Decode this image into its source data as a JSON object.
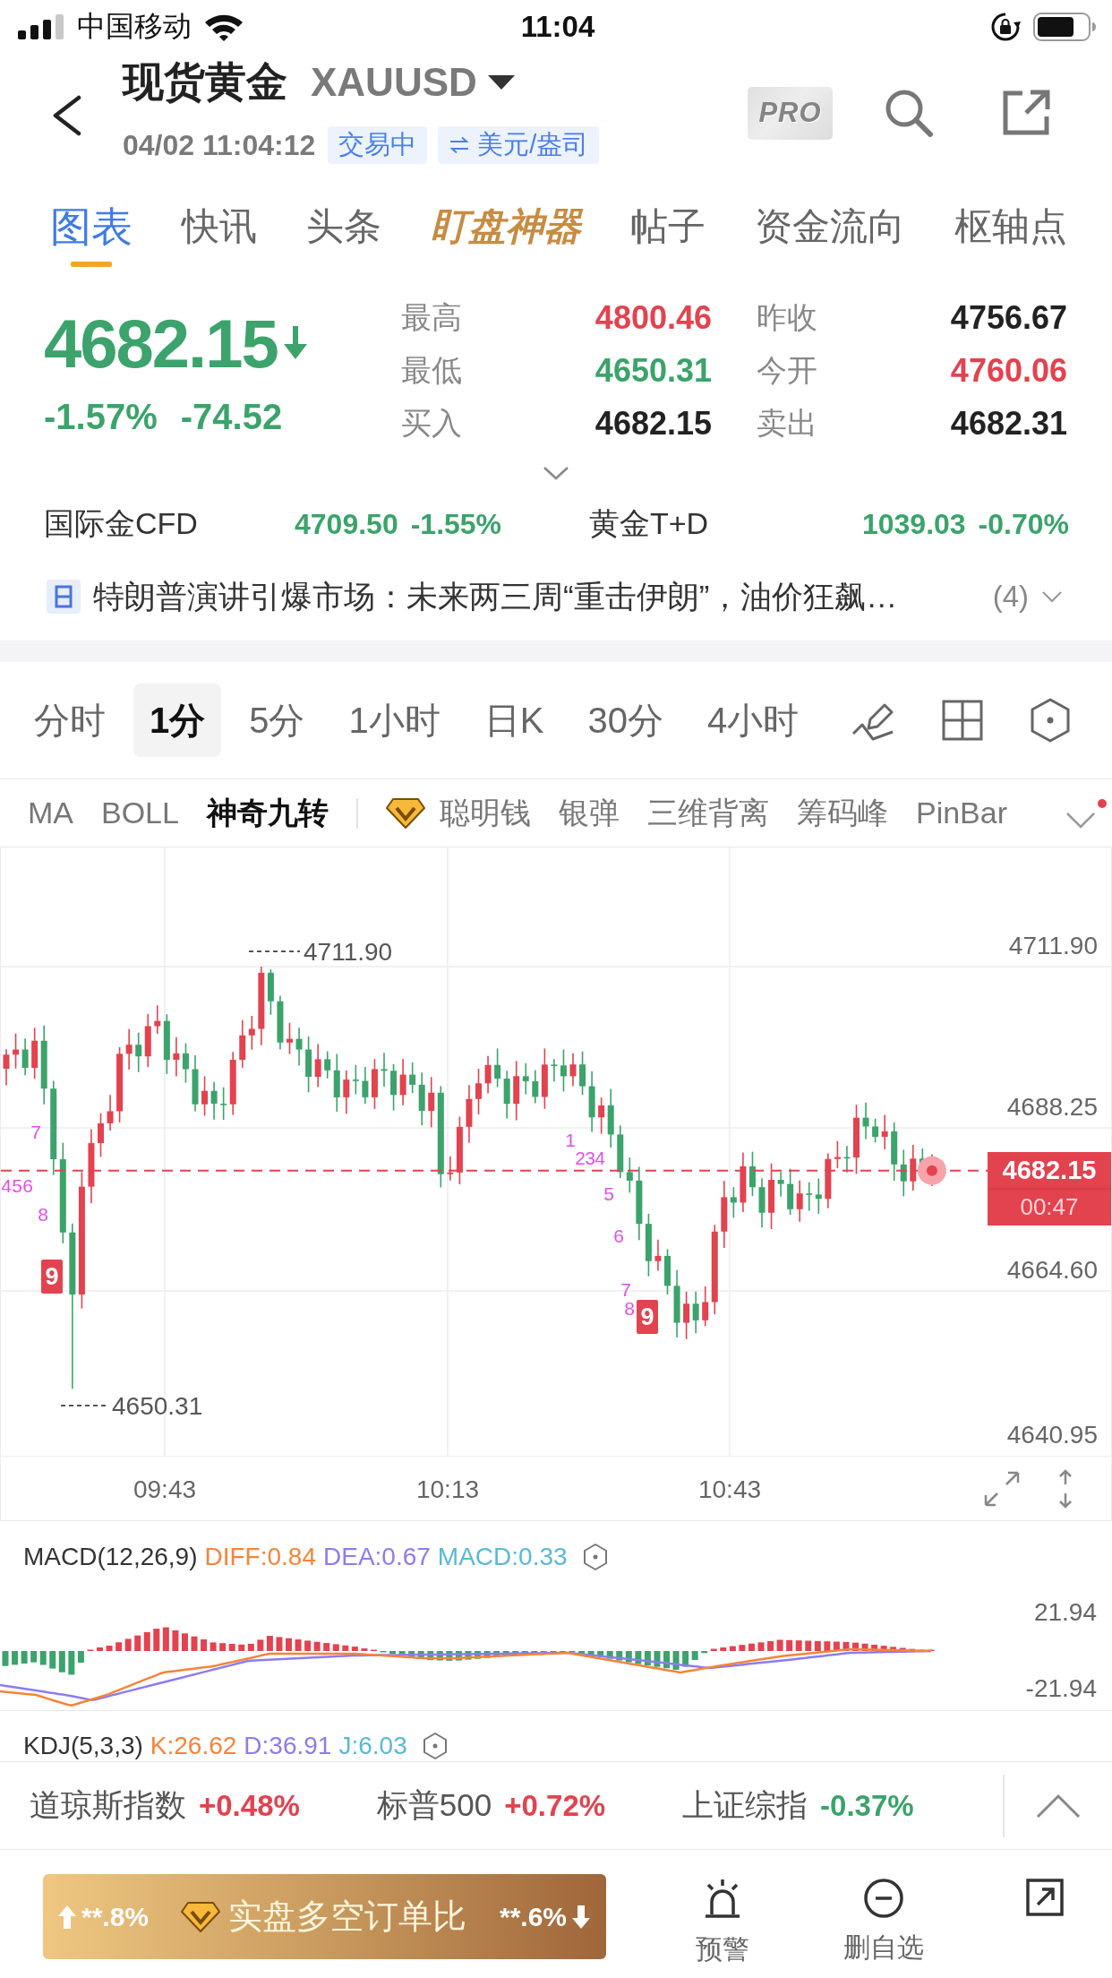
{
  "status_bar": {
    "carrier": "中国移动",
    "time": "11:04"
  },
  "header": {
    "title": "现货黄金",
    "symbol": "XAUUSD",
    "timestamp": "04/02 11:04:12",
    "badges": [
      {
        "kind": "status",
        "label": "交易中"
      },
      {
        "kind": "unit",
        "label": "美元/盎司"
      }
    ],
    "pro_label": "PRO"
  },
  "tabs": [
    {
      "label": "图表",
      "kind": "plain",
      "selected": true
    },
    {
      "label": "快讯",
      "kind": "plain",
      "selected": false
    },
    {
      "label": "头条",
      "kind": "plain",
      "selected": false
    },
    {
      "label": "盯盘神器",
      "kind": "featured",
      "selected": false
    },
    {
      "label": "帖子",
      "kind": "plain",
      "selected": false
    },
    {
      "label": "资金流向",
      "kind": "plain",
      "selected": false
    },
    {
      "label": "枢轴点",
      "kind": "plain",
      "selected": false
    }
  ],
  "quote": {
    "price": "4682.15",
    "falling": true,
    "change_percent": "-1.57%",
    "change": "-74.52"
  },
  "stats": [
    {
      "label": "最高",
      "value": "4800.46",
      "color": "#e3424f"
    },
    {
      "label": "昨收",
      "value": "4756.67",
      "color": "#222222"
    },
    {
      "label": "最低",
      "value": "4650.31",
      "color": "#3ba36b"
    },
    {
      "label": "今开",
      "value": "4760.06",
      "color": "#e3424f"
    },
    {
      "label": "买入",
      "value": "4682.15",
      "color": "#222222"
    },
    {
      "label": "卖出",
      "value": "4682.31",
      "color": "#222222"
    }
  ],
  "related": [
    {
      "name": "国际金CFD",
      "price": "4709.50",
      "change": "-1.55%",
      "color": "#3ba36b"
    },
    {
      "name": "黄金T+D",
      "price": "1039.03",
      "change": "-0.70%",
      "color": "#3ba36b"
    }
  ],
  "news": {
    "headline": "特朗普演讲引爆市场：未来两三周“重击伊朗”，油价狂飙…",
    "count": "(4)"
  },
  "periods": [
    {
      "label": "分时",
      "selected": false
    },
    {
      "label": "1分",
      "selected": true
    },
    {
      "label": "5分",
      "selected": false
    },
    {
      "label": "1小时",
      "selected": false
    },
    {
      "label": "日K",
      "selected": false
    },
    {
      "label": "30分",
      "selected": false
    },
    {
      "label": "4小时",
      "selected": false
    }
  ],
  "indicators": [
    {
      "label": "MA",
      "kind": "plain",
      "selected": false
    },
    {
      "label": "BOLL",
      "kind": "plain",
      "selected": false
    },
    {
      "label": "神奇九转",
      "kind": "plain",
      "selected": true
    },
    {
      "label": "聪明钱",
      "kind": "premium",
      "selected": false
    },
    {
      "label": "银弹",
      "kind": "plain",
      "selected": false
    },
    {
      "label": "三维背离",
      "kind": "plain",
      "selected": false
    },
    {
      "label": "筹码峰",
      "kind": "plain",
      "selected": false
    },
    {
      "label": "PinBar",
      "kind": "plain",
      "selected": false
    }
  ],
  "indicator_menu": {
    "unread": true
  },
  "chart": {
    "y_labels": [
      "4711.90",
      "4688.25",
      "4664.60",
      "4640.95"
    ],
    "high_label": "4711.90",
    "low_label": "4650.31",
    "last_price": "4682.15",
    "countdown": "00:47",
    "markers": [
      {
        "label": "4",
        "kind": "digit"
      },
      {
        "label": "5",
        "kind": "digit"
      },
      {
        "label": "6",
        "kind": "digit"
      },
      {
        "label": "7",
        "kind": "digit"
      },
      {
        "label": "8",
        "kind": "digit"
      },
      {
        "label": "9",
        "kind": "box"
      },
      {
        "label": "1",
        "kind": "digit"
      },
      {
        "label": "2",
        "kind": "digit"
      },
      {
        "label": "3",
        "kind": "digit"
      },
      {
        "label": "4",
        "kind": "digit"
      },
      {
        "label": "5",
        "kind": "digit"
      },
      {
        "label": "6",
        "kind": "digit"
      },
      {
        "label": "7",
        "kind": "digit"
      },
      {
        "label": "8",
        "kind": "digit"
      },
      {
        "label": "9",
        "kind": "box"
      }
    ],
    "x_labels": [
      "09:43",
      "10:13",
      "10:43"
    ]
  },
  "macd": {
    "title": "MACD(12,26,9)",
    "values": [
      {
        "label": "DIFF:0.84",
        "color": "#f5843b"
      },
      {
        "label": "DEA:0.67",
        "color": "#8c7cf0"
      },
      {
        "label": "MACD:0.33",
        "color": "#5ab8d6"
      }
    ],
    "y_labels": [
      "21.94",
      "-21.94"
    ]
  },
  "kdj": {
    "title": "KDJ(5,3,3)",
    "values": [
      {
        "label": "K:26.62",
        "color": "#f5843b"
      },
      {
        "label": "D:36.91",
        "color": "#8c7cf0"
      },
      {
        "label": "J:6.03",
        "color": "#5ab8d6"
      }
    ]
  },
  "indices": [
    {
      "name": "道琼斯指数",
      "change": "+0.48%",
      "color": "#e3424f"
    },
    {
      "name": "标普500",
      "change": "+0.72%",
      "color": "#e3424f"
    },
    {
      "name": "上证综指",
      "change": "-0.37%",
      "color": "#3ba36b"
    }
  ],
  "ratio_button": {
    "long": "**.8%",
    "title": "实盘多空订单比",
    "short": "**.6%"
  },
  "actions": [
    {
      "kind": "alert",
      "label": "预警"
    },
    {
      "kind": "unwatch",
      "label": "删自选"
    },
    {
      "kind": "share"
    }
  ]
}
